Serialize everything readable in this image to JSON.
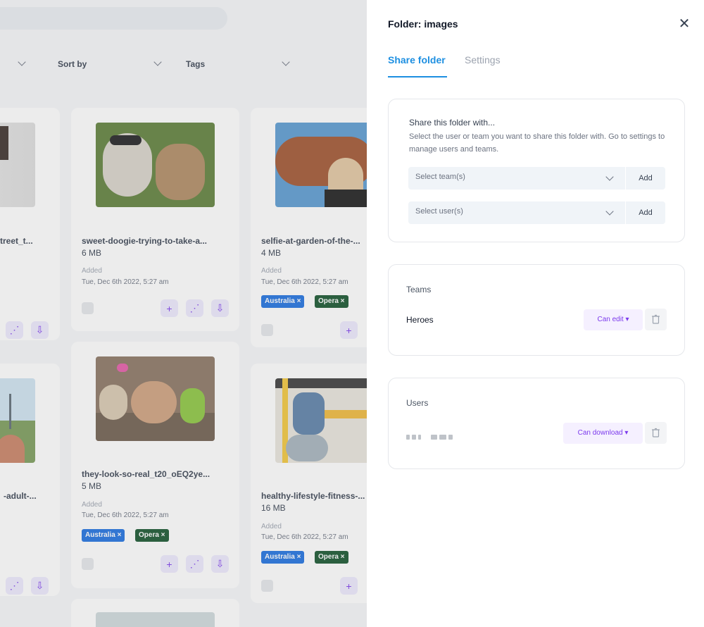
{
  "background": {
    "filters": [
      {
        "label": ""
      },
      {
        "label": "Sort by"
      },
      {
        "label": "Tags"
      }
    ],
    "cards": [
      {
        "name": "treet_t...",
        "size": "",
        "added_label": "",
        "date": ""
      },
      {
        "name": "sweet-doogie-trying-to-take-a...",
        "size": "6 MB",
        "added_label": "Added",
        "date": "Tue, Dec 6th 2022, 5:27 am"
      },
      {
        "name": "selfie-at-garden-of-the-...",
        "size": "4 MB",
        "added_label": "Added",
        "date": "Tue, Dec 6th 2022, 5:27 am",
        "tags": [
          "Australia",
          "Opera"
        ]
      },
      {
        "name": "-adult-...",
        "size": "",
        "added_label": "",
        "date": ""
      },
      {
        "name": "they-look-so-real_t20_oEQ2ye...",
        "size": "5 MB",
        "added_label": "Added",
        "date": "Tue, Dec 6th 2022, 5:27 am",
        "tags": [
          "Australia",
          "Opera"
        ]
      },
      {
        "name": "healthy-lifestyle-fitness-...",
        "size": "16 MB",
        "added_label": "Added",
        "date": "Tue, Dec 6th 2022, 5:27 am",
        "tags": [
          "Australia",
          "Opera"
        ]
      }
    ],
    "tag_colors": {
      "Australia": "#1d6fe0",
      "Opera": "#14532d"
    }
  },
  "drawer": {
    "title": "Folder: images",
    "close_icon": "✕",
    "tabs": [
      {
        "label": "Share folder",
        "active": true
      },
      {
        "label": "Settings",
        "active": false
      }
    ],
    "share": {
      "title": "Share this folder with...",
      "description": "Select the user or team you want to share this folder with. Go to settings to manage users and teams.",
      "team_select_placeholder": "Select team(s)",
      "user_select_placeholder": "Select user(s)",
      "add_label": "Add"
    },
    "teams": {
      "label": "Teams",
      "items": [
        {
          "name": "Heroes",
          "permission": "Can edit ▾"
        }
      ]
    },
    "users": {
      "label": "Users",
      "items": [
        {
          "name": "",
          "permission": "Can download ▾"
        }
      ]
    },
    "accent_color": "#1d8fe1",
    "permission_color": "#7c3aed"
  }
}
